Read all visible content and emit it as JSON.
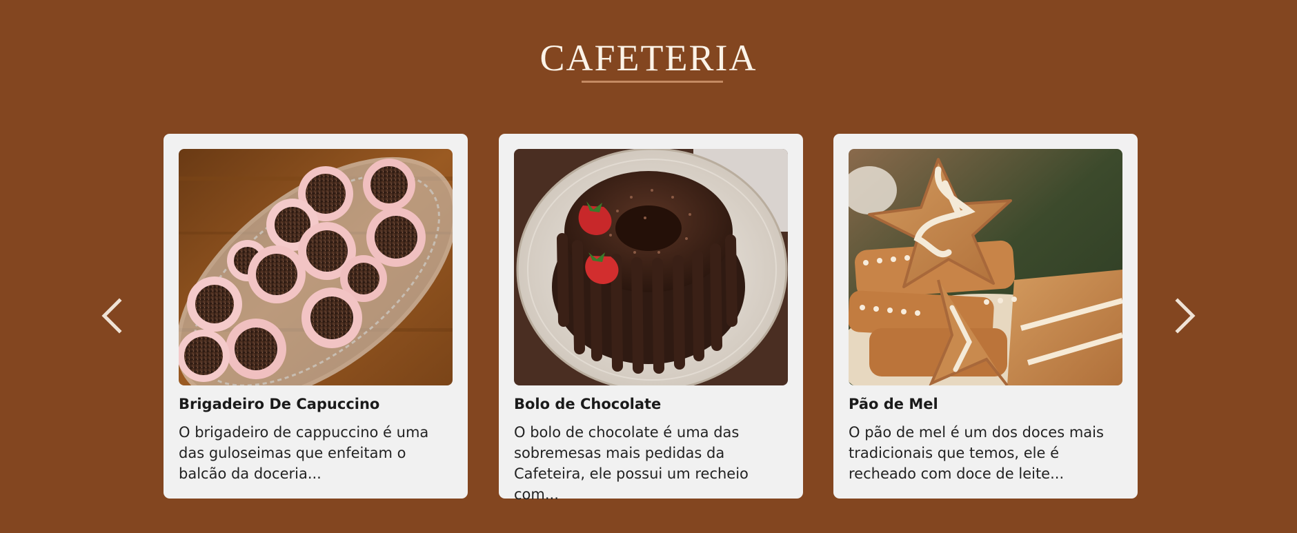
{
  "section": {
    "title": "CAFETERIA"
  },
  "nav": {
    "prev_icon": "chevron-left-icon",
    "next_icon": "chevron-right-icon"
  },
  "cards": [
    {
      "title": "Brigadeiro De Capuccino",
      "description": "O brigadeiro de cappuccino é uma das guloseimas que enfeitam o balcão da doceria..."
    },
    {
      "title": "Bolo de Chocolate",
      "description": "O bolo de chocolate é uma das sobremesas mais pedidas da Cafeteira, ele possui um recheio com..."
    },
    {
      "title": "Pão de Mel",
      "description": "O pão de mel é um dos doces mais tradicionais que temos, ele é recheado com doce de leite..."
    }
  ],
  "colors": {
    "background": "#834620",
    "card": "#f1f1f1",
    "title": "#fbf3e8",
    "underline": "#c58a63"
  }
}
